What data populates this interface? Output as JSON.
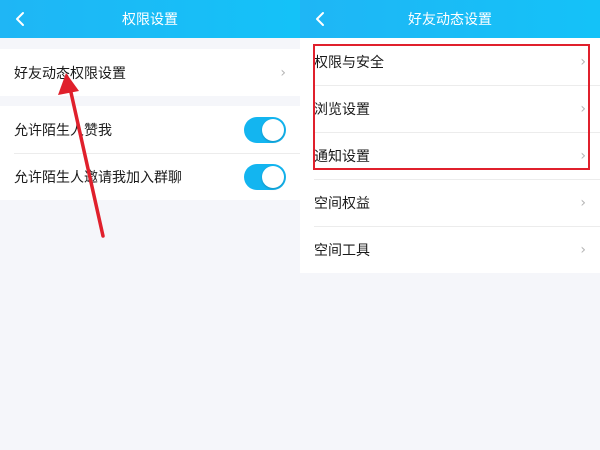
{
  "left_panel": {
    "title": "权限设置",
    "group1": {
      "item_label": "好友动态权限设置",
      "chevron": "›"
    },
    "group2": {
      "items": [
        {
          "label": "允许陌生人赞我",
          "toggle": "on"
        },
        {
          "label": "允许陌生人邀请我加入群聊",
          "toggle": "on"
        }
      ]
    }
  },
  "right_panel": {
    "title": "好友动态设置",
    "items": [
      {
        "label": "权限与安全",
        "chevron": "›"
      },
      {
        "label": "浏览设置",
        "chevron": "›"
      },
      {
        "label": "通知设置",
        "chevron": "›"
      },
      {
        "label": "空间权益",
        "chevron": "›"
      },
      {
        "label": "空间工具",
        "chevron": "›"
      }
    ]
  },
  "colors": {
    "header": "#1fb6f5",
    "toggle_on": "#13b5f0",
    "annotation_red": "#e0202c"
  },
  "icons": {
    "back": "chevron-left-icon",
    "row_arrow": "chevron-right-icon"
  }
}
